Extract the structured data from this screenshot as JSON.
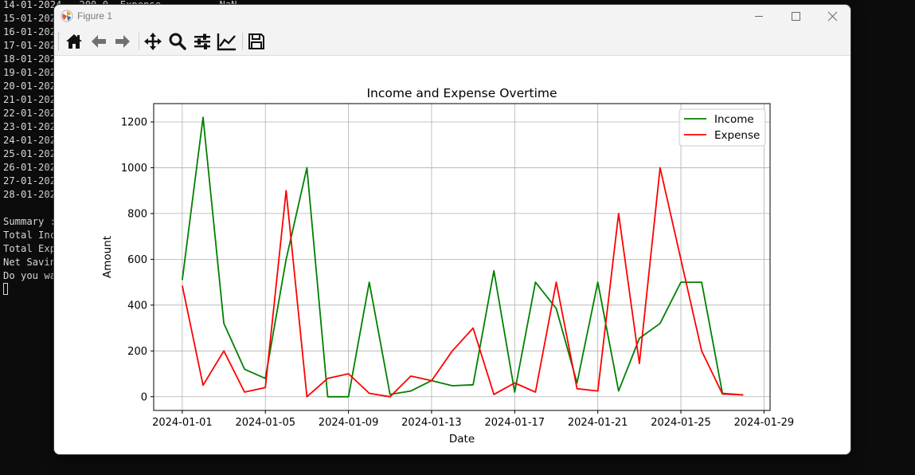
{
  "terminal": {
    "lines": [
      "14-01-2024   200.0  Expense          NaN",
      "15-01-202",
      "16-01-202",
      "17-01-202",
      "18-01-202",
      "19-01-202",
      "20-01-202",
      "21-01-202",
      "22-01-202",
      "23-01-202",
      "24-01-202",
      "25-01-202",
      "26-01-202",
      "27-01-202",
      "28-01-202",
      "",
      "Summary :",
      "Total Inc",
      "Total Exp",
      "Net Savin",
      "Do you wa"
    ]
  },
  "window": {
    "title": "Figure 1",
    "controls": [
      "minimize",
      "maximize",
      "close"
    ]
  },
  "toolbar": {
    "buttons": [
      {
        "name": "home",
        "icon": "home-icon"
      },
      {
        "name": "back",
        "icon": "arrow-left-icon"
      },
      {
        "name": "forward",
        "icon": "arrow-right-icon"
      },
      {
        "name": "pan",
        "icon": "move-icon"
      },
      {
        "name": "zoom",
        "icon": "magnifier-icon"
      },
      {
        "name": "subplots",
        "icon": "sliders-icon"
      },
      {
        "name": "edit-axis",
        "icon": "chart-line-icon"
      },
      {
        "name": "save",
        "icon": "floppy-disk-icon"
      }
    ]
  },
  "chart_data": {
    "type": "line",
    "title": "Income and Expense Overtime",
    "xlabel": "Date",
    "ylabel": "Amount",
    "x": [
      "2024-01-01",
      "2024-01-02",
      "2024-01-03",
      "2024-01-04",
      "2024-01-05",
      "2024-01-06",
      "2024-01-07",
      "2024-01-08",
      "2024-01-09",
      "2024-01-10",
      "2024-01-11",
      "2024-01-12",
      "2024-01-13",
      "2024-01-14",
      "2024-01-15",
      "2024-01-16",
      "2024-01-17",
      "2024-01-18",
      "2024-01-19",
      "2024-01-20",
      "2024-01-21",
      "2024-01-22",
      "2024-01-23",
      "2024-01-24",
      "2024-01-25",
      "2024-01-26",
      "2024-01-27",
      "2024-01-28"
    ],
    "series": [
      {
        "name": "Income",
        "color": "#008000",
        "values": [
          510,
          1220,
          320,
          120,
          80,
          600,
          1000,
          0,
          0,
          500,
          10,
          25,
          70,
          48,
          52,
          550,
          20,
          500,
          385,
          60,
          500,
          25,
          255,
          320,
          500,
          500,
          15,
          8
        ]
      },
      {
        "name": "Expense",
        "color": "#ff0000",
        "values": [
          485,
          50,
          200,
          20,
          40,
          900,
          0,
          80,
          100,
          15,
          0,
          90,
          70,
          200,
          300,
          10,
          60,
          20,
          500,
          35,
          25,
          800,
          145,
          1000,
          600,
          200,
          12,
          8
        ]
      }
    ],
    "xticks": [
      "2024-01-01",
      "2024-01-05",
      "2024-01-09",
      "2024-01-13",
      "2024-01-17",
      "2024-01-21",
      "2024-01-25",
      "2024-01-29"
    ],
    "yticks": [
      0,
      200,
      400,
      600,
      800,
      1000,
      1200
    ],
    "xlim": [
      "2023-12-30T15:00",
      "2024-01-29T07:00"
    ],
    "ylim": [
      -60,
      1280
    ],
    "grid": true,
    "legend": "top-right"
  }
}
